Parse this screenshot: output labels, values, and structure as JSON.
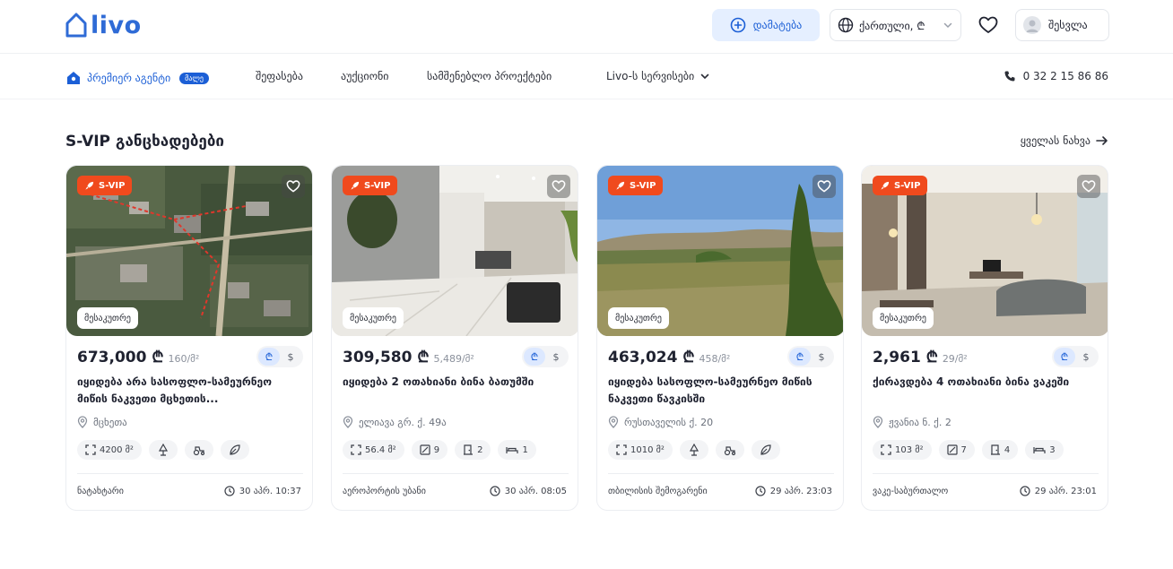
{
  "header": {
    "logo_text": "livo",
    "add_label": "დამატება",
    "lang_label": "ქართული, ₾",
    "login_label": "შესვლა"
  },
  "nav": {
    "premier_label": "პრემიერ აგენტი",
    "premier_badge": "მალე",
    "items": [
      {
        "label": "შეფასება"
      },
      {
        "label": "აუქციონი"
      },
      {
        "label": "სამშენებლო პროექტები"
      },
      {
        "label": "Livo-ს სერვისები"
      }
    ],
    "phone": "0 32 2 15 86 86"
  },
  "section": {
    "title": "S-VIP განცხადებები",
    "see_all": "ყველას ნახვა"
  },
  "colors": {
    "brand": "#2f6bd6",
    "svip": "#f04a1d",
    "accent_light": "#e5efff"
  },
  "cards": [
    {
      "badge": "S-VIP",
      "owner": "მესაკუთრე",
      "price": "673,000 ₾",
      "per_m2": "160/მ²",
      "cur_gel": "₾",
      "cur_usd": "$",
      "title": "იყიდება არა სასოფლო-სამეურნეო მიწის ნაკვეთი მცხეთის...",
      "address": "მცხეთა",
      "features": [
        {
          "icon": "area-icon",
          "value": "4200 მ²"
        },
        {
          "icon": "tree-icon",
          "value": ""
        },
        {
          "icon": "tractor-icon",
          "value": ""
        },
        {
          "icon": "leaf-icon",
          "value": ""
        }
      ],
      "district": "ნატახტარი",
      "date": "30 აპრ. 10:37"
    },
    {
      "badge": "S-VIP",
      "owner": "მესაკუთრე",
      "price": "309,580 ₾",
      "per_m2": "5,489/მ²",
      "cur_gel": "₾",
      "cur_usd": "$",
      "title": "იყიდება 2 ოთახიანი ბინა ბათუმში",
      "address": "ელიავა გრ. ქ. 49ა",
      "features": [
        {
          "icon": "area-icon",
          "value": "56.4 მ²"
        },
        {
          "icon": "floor-icon",
          "value": "9"
        },
        {
          "icon": "door-icon",
          "value": "2"
        },
        {
          "icon": "bed-icon",
          "value": "1"
        }
      ],
      "district": "აეროპორტის უბანი",
      "date": "30 აპრ. 08:05"
    },
    {
      "badge": "S-VIP",
      "owner": "მესაკუთრე",
      "price": "463,024 ₾",
      "per_m2": "458/მ²",
      "cur_gel": "₾",
      "cur_usd": "$",
      "title": "იყიდება სასოფლო-სამეურნეო მიწის ნაკვეთი წავკისში",
      "address": "რუსთაველის ქ. 20",
      "features": [
        {
          "icon": "area-icon",
          "value": "1010 მ²"
        },
        {
          "icon": "tree-icon",
          "value": ""
        },
        {
          "icon": "tractor-icon",
          "value": ""
        },
        {
          "icon": "leaf-icon",
          "value": ""
        }
      ],
      "district": "თბილისის შემოგარენი",
      "date": "29 აპრ. 23:03"
    },
    {
      "badge": "S-VIP",
      "owner": "მესაკუთრე",
      "price": "2,961 ₾",
      "per_m2": "29/მ²",
      "cur_gel": "₾",
      "cur_usd": "$",
      "title": "ქირავდება 4 ოთახიანი ბინა ვაკეში",
      "address": "ჟვანია ნ. ქ. 2",
      "features": [
        {
          "icon": "area-icon",
          "value": "103 მ²"
        },
        {
          "icon": "floor-icon",
          "value": "7"
        },
        {
          "icon": "door-icon",
          "value": "4"
        },
        {
          "icon": "bed-icon",
          "value": "3"
        }
      ],
      "district": "ვაკე-საბურთალო",
      "date": "29 აპრ. 23:01"
    }
  ]
}
